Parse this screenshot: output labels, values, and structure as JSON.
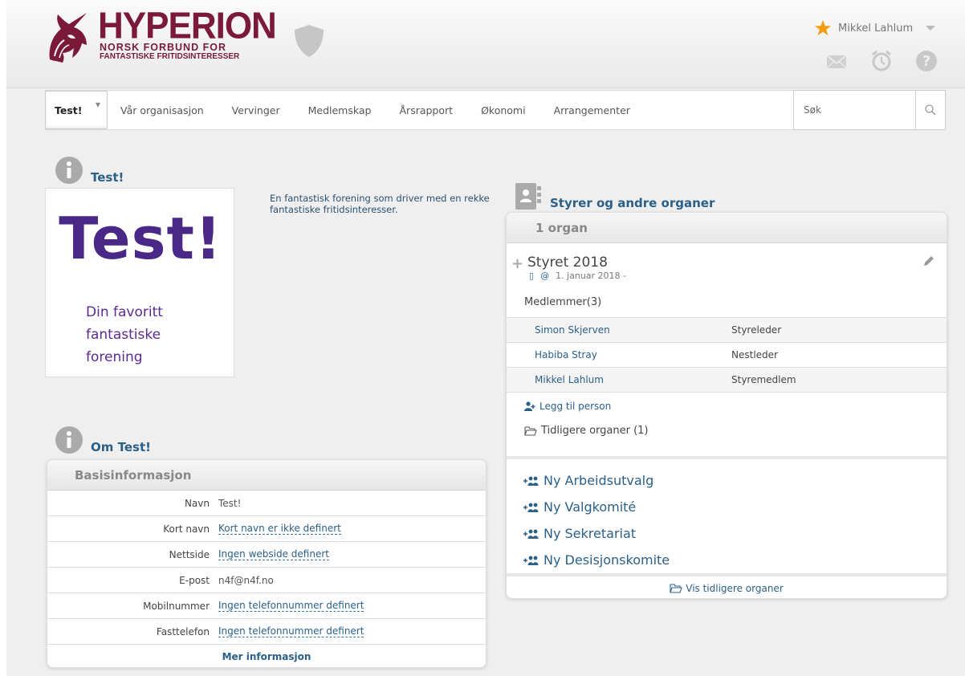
{
  "brand": {
    "title": "HYPERION",
    "line1": "NORSK FORBUND FOR",
    "line2": "FANTASTISKE FRITIDSINTERESSER",
    "color": "#7a1a38"
  },
  "user": {
    "name": "Mikkel Lahlum"
  },
  "header_icons": [
    "mail-icon",
    "alarm-clock-icon",
    "help-icon"
  ],
  "nav": {
    "dropdown": "Test!",
    "items": [
      "Vår organisasjon",
      "Vervinger",
      "Medlemskap",
      "Årsrapport",
      "Økonomi",
      "Arrangementer"
    ],
    "search_placeholder": "Søk"
  },
  "intro": {
    "heading": "Test!",
    "image_title": "Test!",
    "image_tagline": [
      "Din favoritt",
      "fantastiske",
      "forening"
    ],
    "description": "En fantastisk forening som driver med en rekke fantastiske fritidsinteresser."
  },
  "about": {
    "heading": "Om Test!",
    "panel_title": "Basisinformasjon",
    "rows": [
      {
        "key": "Navn",
        "value": "Test!"
      },
      {
        "key": "Kort navn",
        "value": "Kort navn er ikke definert"
      },
      {
        "key": "Nettside",
        "value": "Ingen webside definert"
      },
      {
        "key": "E-post",
        "value": "n4f@n4f.no"
      },
      {
        "key": "Mobilnummer",
        "value": "Ingen telefonnummer definert"
      },
      {
        "key": "Fasttelefon",
        "value": "Ingen telefonnummer definert"
      }
    ],
    "more": "Mer informasjon"
  },
  "boards": {
    "heading": "Styrer og andre organer",
    "count_label": "1 organ",
    "organ": {
      "name": "Styret 2018",
      "date": "1. januar 2018 -",
      "members_label": "Medlemmer(3)",
      "members": [
        {
          "name": "Simon Skjerven",
          "role": "Styreleder"
        },
        {
          "name": "Habiba Stray",
          "role": "Nestleder"
        },
        {
          "name": "Mikkel Lahlum",
          "role": "Styremedlem"
        }
      ],
      "add_person": "Legg til person",
      "previous": "Tidligere organer (1)"
    },
    "new_items": [
      "Ny Arbeidsutvalg",
      "Ny Valgkomité",
      "Ny Sekretariat",
      "Ny Desisjonskomite"
    ],
    "show_previous": "Vis tidligere organer"
  },
  "colors": {
    "link": "#2a5f88",
    "brand": "#7a1a38",
    "star": "#f39c12"
  }
}
